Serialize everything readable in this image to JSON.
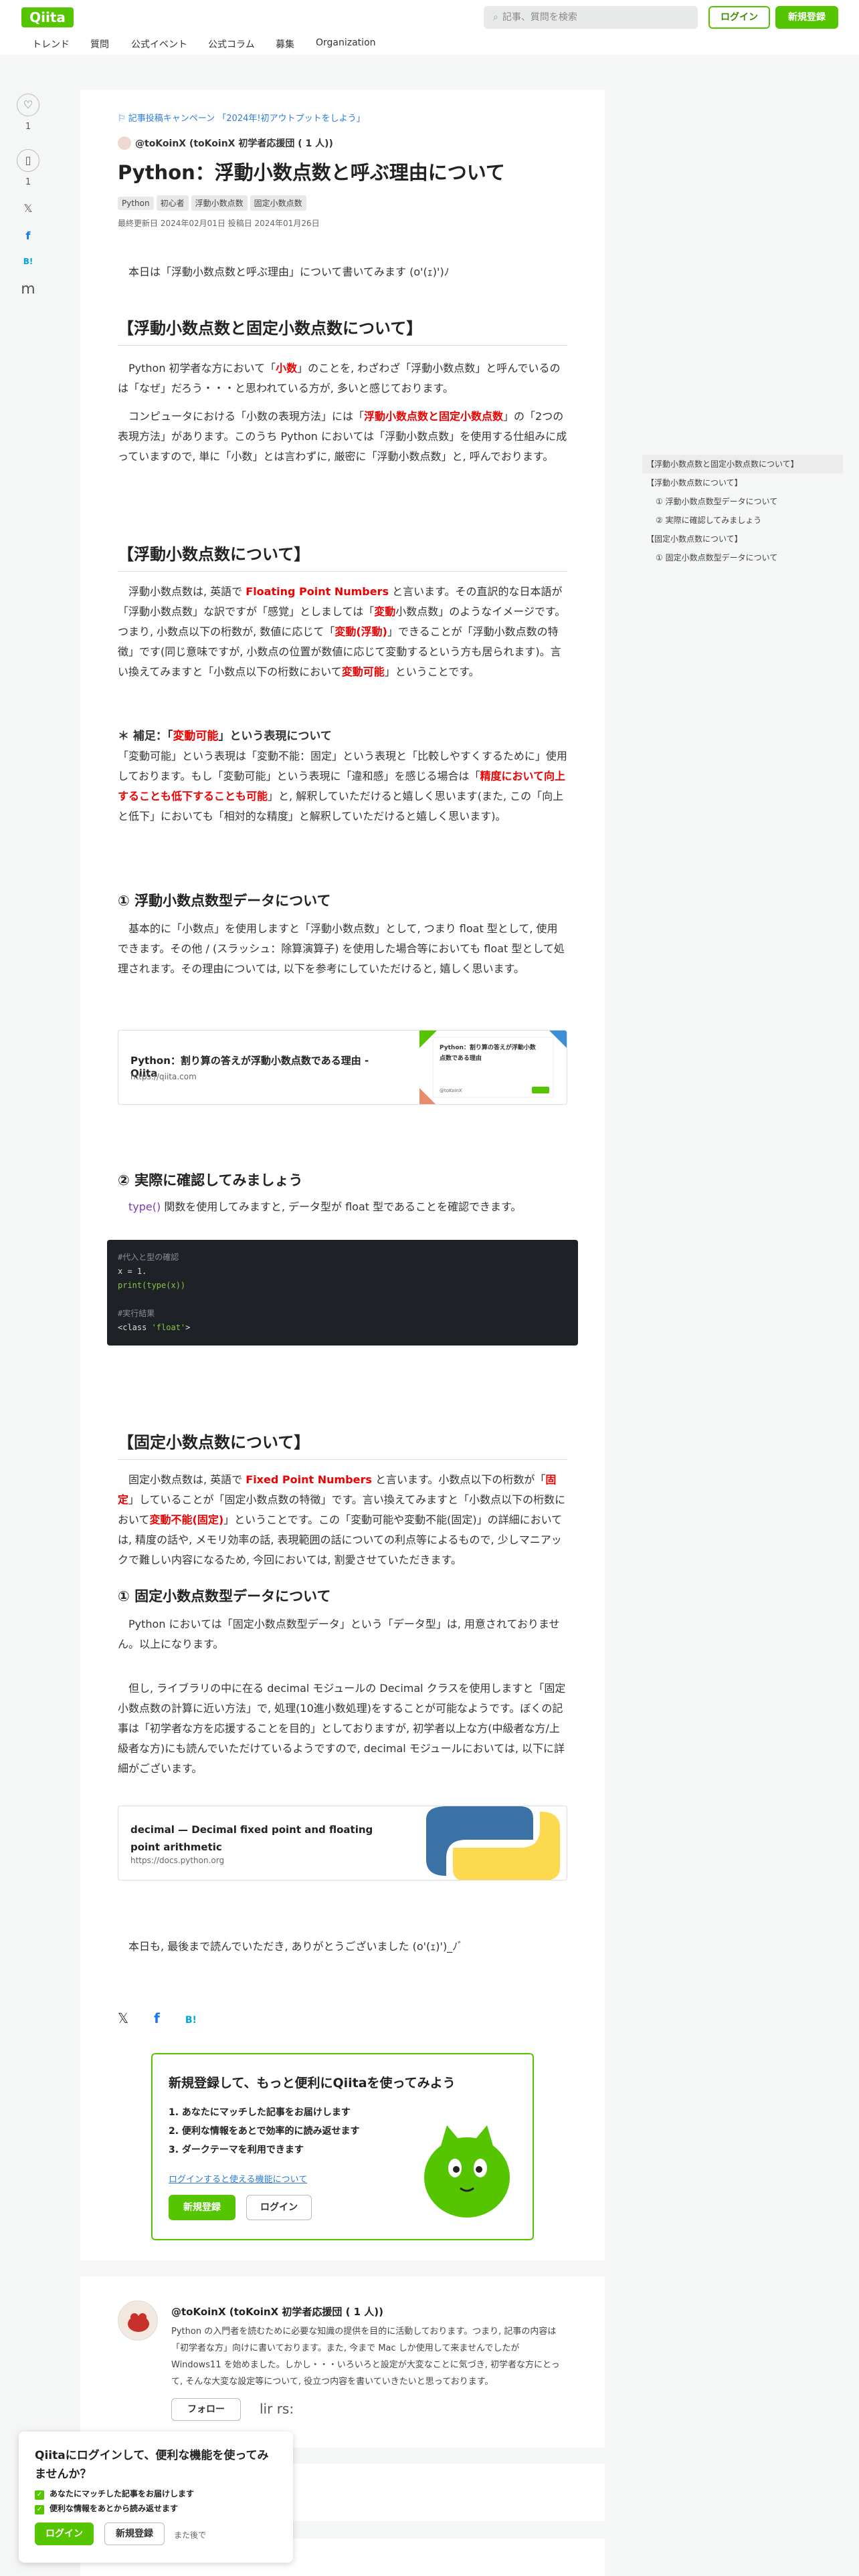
{
  "header": {
    "logo": "Qiita",
    "search_placeholder": "記事、質問を検索",
    "login": "ログイン",
    "signup": "新規登録",
    "nav": [
      "トレンド",
      "質問",
      "公式イベント",
      "公式コラム",
      "募集",
      "Organization"
    ]
  },
  "side_actions": {
    "like_count": "1",
    "stock_count": "1",
    "x_icon": "𝕏",
    "fb_icon": "f",
    "hatena_icon": "B!",
    "m_icon": "m"
  },
  "article": {
    "campaign": "記事投稿キャンペーン 「2024年!初アウトプットをしよう」",
    "author": "@toKoinX (toKoinX 初学者応援団 ( 1 人))",
    "title": "Python：浮動小数点数と呼ぶ理由について",
    "tags": [
      "Python",
      "初心者",
      "浮動小数点数",
      "固定小数点数"
    ],
    "dates": "最終更新日 2024年02月01日   投稿日 2024年01月26日",
    "intro": "本日は「浮動小数点数と呼ぶ理由」について書いてみます (o'(ｪ)')ﾉ",
    "s1_title": "【浮動小数点数と固定小数点数について】",
    "s1_p1_a": "Python 初学者な方において「",
    "s1_p1_b": "小数",
    "s1_p1_c": "」のことを, わざわざ「浮動小数点数」と呼んでいるのは「なぜ」だろう・・・と思われている方が, 多いと感じております。",
    "s1_p2_a": "コンピュータにおける「小数の表現方法」には「",
    "s1_p2_b": "浮動小数点数と固定小数点数",
    "s1_p2_c": "」の「2つの表現方法」があります。このうち Python においては「浮動小数点数」を使用する仕組みに成っていますので, 単に「小数」とは言わずに, 厳密に「浮動小数点数」と, 呼んでおります。",
    "s2_title": "【浮動小数点数について】",
    "s2_p_a": "浮動小数点数は, 英語で ",
    "s2_p_b": "Floating Point Numbers",
    "s2_p_c": " と言います。その直訳的な日本語が「浮動小数点数」な訳ですが「感覚」としましては「",
    "s2_p_d": "変動",
    "s2_p_e": "小数点数」のようなイメージです。つまり, 小数点以下の桁数が, 数値に応じて「",
    "s2_p_f": "変動(浮動)",
    "s2_p_g": "」できることが「浮動小数点数の特徴」です(同じ意味ですが, 小数点の位置が数値に応じて変動するという方も居られます)。言い換えてみますと「小数点以下の桁数において",
    "s2_p_h": "変動可能",
    "s2_p_i": "」ということです。",
    "note_a": "＊ 補足：「",
    "note_b": "変動可能",
    "note_c": "」という表現について",
    "note_p_a": "「変動可能」という表現は「変動不能：固定」という表現と「比較しやすくするために」使用しております。もし「変動可能」という表現に「違和感」を感じる場合は「",
    "note_p_b": "精度において向上することも低下することも可能",
    "note_p_c": "」と, 解釈していただけると嬉しく思います(また, この「向上と低下」においても「相対的な精度」と解釈していただけると嬉しく思います)。",
    "s2_h2a": "① 浮動小数点数型データについて",
    "s2_h2a_p": "基本的に「小数点」を使用しますと「浮動小数点数」として, つまり float 型として, 使用できます。その他 / (スラッシュ：除算演算子) を使用した場合等においても float 型として処理されます。その理由については, 以下を参考にしていただけると, 嬉しく思います。",
    "card1_title": "Python：割り算の答えが浮動小数点数である理由 - Qiita",
    "card1_url": "https://qiita.com",
    "card1_thumb_text": "Python：割り算の答えが浮動小数点数である理由",
    "card1_thumb_user": "@toKoinX",
    "s2_h2b": "② 実際に確認してみましょう",
    "s2_h2b_p_a": "type()",
    "s2_h2b_p_b": " 関数を使用してみますと, データ型が float 型であることを確認できます。",
    "code": {
      "c1": "#代入と型の確認",
      "l1": "x = 1.",
      "l2": "print(type(x))",
      "c2": "#実行結果",
      "l3a": "<class ",
      "l3b": "'float'",
      "l3c": ">"
    },
    "s3_title": "【固定小数点数について】",
    "s3_p_a": "固定小数点数は, 英語で ",
    "s3_p_b": "Fixed Point Numbers",
    "s3_p_c": " と言います。小数点以下の桁数が「",
    "s3_p_d": "固定",
    "s3_p_e": "」していることが「固定小数点数の特徴」です。言い換えてみますと「小数点以下の桁数において",
    "s3_p_f": "変動不能(固定)",
    "s3_p_g": "」ということです。この「変動可能や変動不能(固定)」の詳細においては, 精度の話や, メモリ効率の話, 表現範囲の話についての利点等によるもので, 少しマニアックで難しい内容になるため, 今回においては, 割愛させていただきます。",
    "s3_h2": "① 固定小数点数型データについて",
    "s3_p2": "Python においては「固定小数点数型データ」という「データ型」は, 用意されておりません。以上になります。",
    "s3_p3": "但し, ライブラリの中に在る decimal モジュールの Decimal クラスを使用しますと「固定小数点数の計算に近い方法」で, 処理(10進小数処理)をすることが可能なようです。ぼくの記事は「初学者な方を応援することを目的」としておりますが, 初学者以上な方(中級者な方/上級者な方)にも読んでいただけているようですので, decimal モジュールにおいては, 以下に詳細がございます。",
    "card2_title": "decimal — Decimal fixed point and floating point arithmetic",
    "card2_url": "https://docs.python.org",
    "outro": "本日も, 最後まで読んでいただき, ありがとうございました (o'(ｪ)')_ﾉﾞ",
    "share": {
      "x": "𝕏",
      "fb": "f",
      "hatena": "B!"
    }
  },
  "signup_box": {
    "title": "新規登録して、もっと便利にQiitaを使ってみよう",
    "items": [
      "1. あなたにマッチした記事をお届けします",
      "2. 便利な情報をあとで効率的に読み返せます",
      "3. ダークテーマを利用できます"
    ],
    "link": "ログインすると使える機能について",
    "signup": "新規登録",
    "login": "ログイン"
  },
  "toc": [
    "【浮動小数点数と固定小数点数について】",
    "【浮動小数点数について】",
    "① 浮動小数点数型データについて",
    "② 実際に確認してみましょう",
    "【固定小数点数について】",
    "① 固定小数点数型データについて"
  ],
  "author_card": {
    "name": "@toKoinX (toKoinX 初学者応援団 ( 1 人))",
    "desc": "Python の入門者を読むために必要な知識の提供を目的に活動しております。つまり, 記事の内容は「初学者な方」向けに書いております。また, 今まで Mac しか使用して来ませんでしたが Windows11 を始めました。しかし・・・いろいろと設定が大変なことに気づき, 初学者な方にとって, そんな大変な設定等について, 役立つ内容を書いていきたいと思っております。",
    "follow": "フォロー",
    "extra": "lir    rs:"
  },
  "login_popup": {
    "title": "Qiitaにログインして、便利な機能を使ってみませんか？",
    "items": [
      "あなたにマッチした記事をお届けします",
      "便利な情報をあとから読み返せます"
    ],
    "login": "ログイン",
    "signup": "新規登録",
    "later": "また後で"
  },
  "colors": {
    "brand": "#55c500",
    "accent_red": "#e00",
    "link": "#2c7cd6",
    "code_bg": "#1e2125"
  }
}
